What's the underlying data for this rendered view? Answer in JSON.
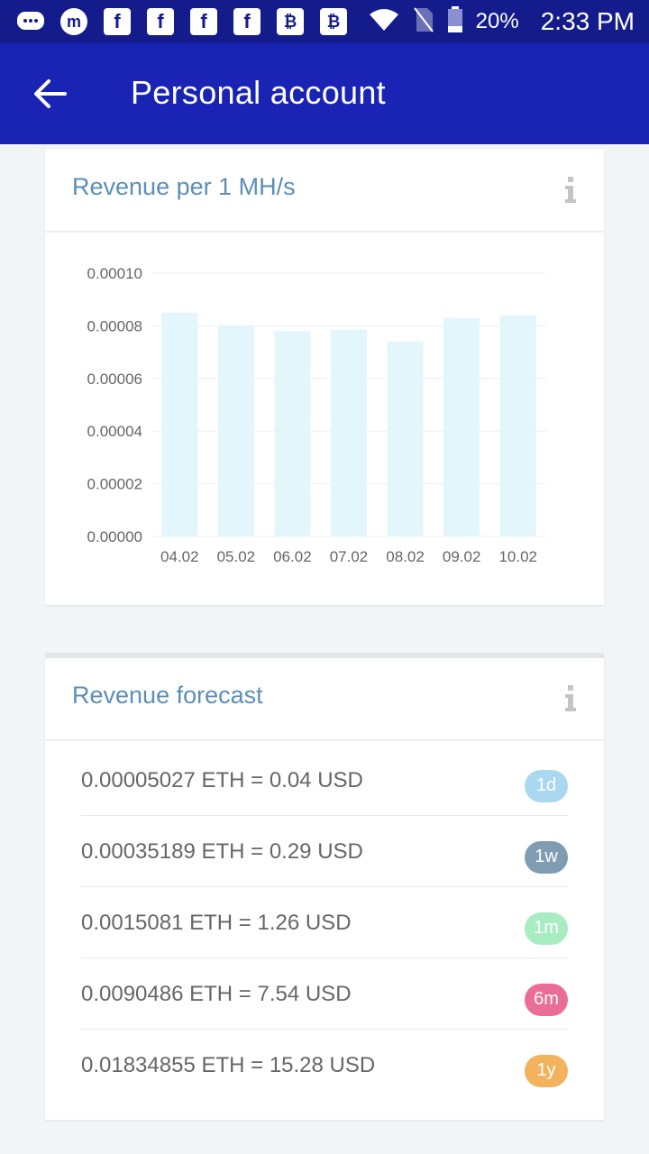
{
  "status_bar": {
    "notification_icons": [
      "messages-icon",
      "app-m-icon",
      "facebook-icon",
      "facebook-icon",
      "facebook-icon",
      "facebook-icon",
      "bitcoin-icon",
      "bitcoin-icon"
    ],
    "battery_percent": "20%",
    "time": "2:33 PM"
  },
  "app_bar": {
    "title": "Personal account"
  },
  "revenue_card": {
    "title": "Revenue per 1 MH/s"
  },
  "forecast_card": {
    "title": "Revenue forecast",
    "rows": [
      {
        "text": "0.00005027 ETH = 0.04 USD",
        "badge": "1d",
        "badge_color": "#a9d8f0"
      },
      {
        "text": "0.00035189 ETH = 0.29 USD",
        "badge": "1w",
        "badge_color": "#7f9cb3"
      },
      {
        "text": "0.0015081 ETH = 1.26 USD",
        "badge": "1m",
        "badge_color": "#a8ecc2"
      },
      {
        "text": "0.0090486 ETH = 7.54 USD",
        "badge": "6m",
        "badge_color": "#ea6d98"
      },
      {
        "text": "0.01834855 ETH = 15.28 USD",
        "badge": "1y",
        "badge_color": "#f2b25e"
      }
    ]
  },
  "chart_data": {
    "type": "bar",
    "categories": [
      "04.02",
      "05.02",
      "06.02",
      "07.02",
      "08.02",
      "09.02",
      "10.02"
    ],
    "values": [
      8.5e-05,
      8e-05,
      7.8e-05,
      7.85e-05,
      7.4e-05,
      8.3e-05,
      8.4e-05
    ],
    "yticks": [
      "0.00000",
      "0.00002",
      "0.00004",
      "0.00006",
      "0.00008",
      "0.00010"
    ],
    "ylim": [
      0,
      0.0001
    ],
    "bar_color": "#e2f6fb",
    "grid": true
  }
}
